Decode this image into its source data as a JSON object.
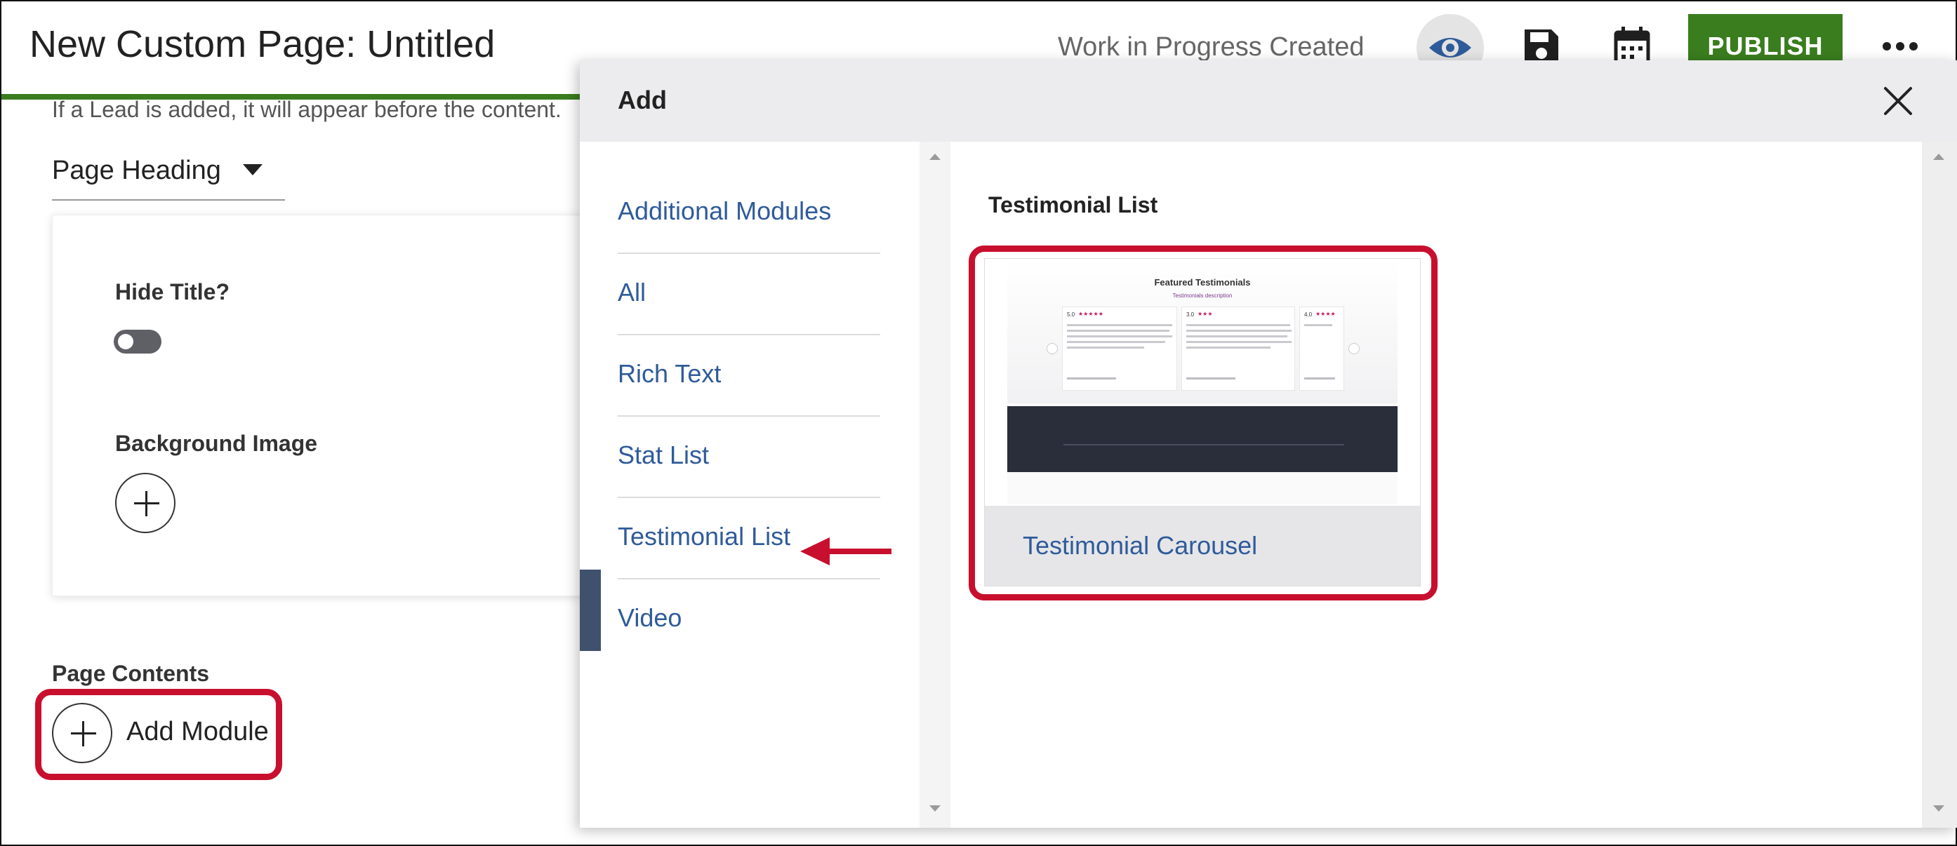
{
  "header": {
    "title": "New Custom Page: Untitled",
    "status": "Work in Progress Created",
    "publish_label": "PUBLISH",
    "icons": [
      "eye-icon",
      "save-icon",
      "calendar-icon",
      "more-icon"
    ],
    "accent_color": "#3a7d1e"
  },
  "editor": {
    "lead_note": "If a Lead is added, it will appear before the content.",
    "heading_select_value": "Page Heading",
    "hide_title_label": "Hide Title?",
    "background_image_label": "Background Image",
    "page_contents_label": "Page Contents",
    "add_module_label": "Add Module"
  },
  "dialog": {
    "title": "Add",
    "categories": [
      {
        "label": "Additional Modules"
      },
      {
        "label": "All"
      },
      {
        "label": "Rich Text"
      },
      {
        "label": "Stat List"
      },
      {
        "label": "Testimonial List"
      },
      {
        "label": "Video"
      }
    ],
    "selected_category": "Testimonial List",
    "section_heading": "Testimonial List",
    "module": {
      "label": "Testimonial Carousel",
      "thumbnail": {
        "title": "Featured Testimonials",
        "description": "Testimonials description",
        "ratings": [
          "5.0",
          "3.0",
          "4.0"
        ]
      }
    }
  },
  "highlight_color": "#c8102e"
}
